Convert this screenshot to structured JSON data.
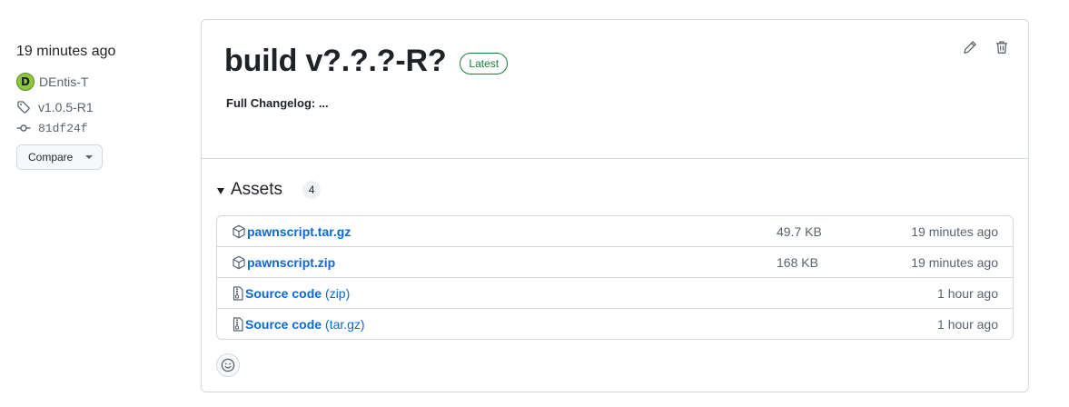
{
  "meta": {
    "time": "19 minutes ago",
    "author": "DEntis-T",
    "avatar_letter": "D",
    "tag": "v1.0.5-R1",
    "commit": "81df24f",
    "compare_label": "Compare"
  },
  "release": {
    "title": "build v?.?.?-R?",
    "badge": "Latest",
    "body": "Full Changelog: ...",
    "assets_label": "Assets",
    "assets_count": "4",
    "assets": [
      {
        "icon": "package-icon",
        "name": "pawnscript.tar.gz",
        "suffix": "",
        "size": "49.7 KB",
        "time": "19 minutes ago"
      },
      {
        "icon": "package-icon",
        "name": "pawnscript.zip",
        "suffix": "",
        "size": "168 KB",
        "time": "19 minutes ago"
      },
      {
        "icon": "file-zip-icon",
        "name": "Source code",
        "suffix": "(zip)",
        "size": "",
        "time": "1 hour ago"
      },
      {
        "icon": "file-zip-icon",
        "name": "Source code",
        "suffix": "(tar.gz)",
        "size": "",
        "time": "1 hour ago"
      }
    ]
  },
  "colors": {
    "accent_link": "#0969da",
    "badge_green": "#1a7f37",
    "border": "#d1d9e0",
    "muted": "#59636e"
  }
}
